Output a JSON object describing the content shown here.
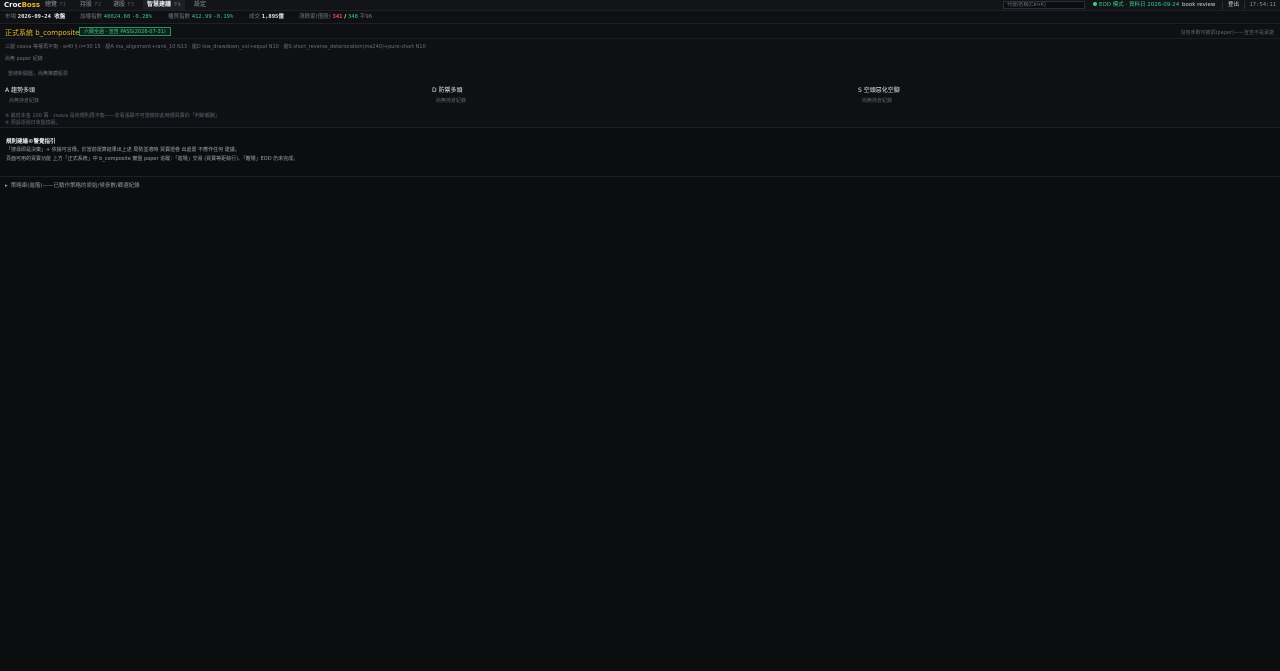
{
  "topbar": {
    "brand_a": "Croc",
    "brand_b": "Boss",
    "tabs": [
      {
        "label": "總覽",
        "key": "F1"
      },
      {
        "label": "持股",
        "key": "F2"
      },
      {
        "label": "選股",
        "key": "F3"
      },
      {
        "label": "智慧建議",
        "key": "F4"
      },
      {
        "label": "設定",
        "key": ""
      }
    ],
    "search_placeholder": "代號/名稱(Ctrl+K)",
    "eod_status": "EOD 模式 · 資料日 2026-09-24",
    "book_review": "book review",
    "logout": "登出",
    "clock": "17:54:11"
  },
  "market": {
    "label_market": "市場",
    "market_value": "2026-09-24 收盤",
    "label_taiex": "加權指數",
    "taiex_value": "40024.60",
    "taiex_change": "-0.28%",
    "label_otc": "櫃買指數",
    "otc_value": "412.99",
    "otc_change": "-0.19%",
    "label_volume": "成交",
    "volume_value": "1,895億",
    "label_breadth": "漲跌家(僅股)",
    "breadth_up": "341",
    "breadth_sep": "/",
    "breadth_down": "348",
    "breadth_flat": "平96"
  },
  "panel": {
    "formal_label": "正式系統 b_composite",
    "pass_badge": "六關全過 · 宣告 PASS(2026-07-31)",
    "right_note": "沒有參數可被調(paper)——宣告不是承諾",
    "line1": "三腿 ceava 等權再平衡 · w40 § n=30 15 · 腿A ma_alignment+rank_10 N13 · 腿D low_drawdown_vol+equal N10 · 腿S short_reverse_deterioration(ma240)+pure-short N10",
    "line2": "尚無 paper 紀錄",
    "line3": "當待新開盤，尚無推薦股票",
    "columns": [
      {
        "title": "A 趨勢多頭",
        "sub": "尚無持倉紀錄"
      },
      {
        "title": "D 防禦多頭",
        "sub": "尚無持倉紀錄"
      },
      {
        "title": "S 空頭惡化空腳",
        "sub": "尚無持倉紀錄"
      }
    ],
    "foot1": "※ 最低本金 100 萬 · ceava 是依規則再平衡——非看漲跌不可當做依此時價買賣的「判斷報酬」",
    "foot2": "※ 預設逐週日收盤換股。"
  },
  "disclaimer": {
    "title": "規則建議©警覺指引",
    "line1": "「搜尋即是決策」+ 依據可言傳。於當前運算結果出上述 局勢並適時 買賣證卷 出處置 不應作任何 建議。",
    "line2": "頁面可用的買賣功能 上方「正式系統」中 b_composite 實盤 paper 追蹤：「進場」交易 (買賣等距執行)、「離場」EOD 仍未完成。"
  },
  "expander": {
    "caret": "▸",
    "label": "策略庫(進階)——已驗作策略的原始/候參數/篩選紀錄"
  }
}
